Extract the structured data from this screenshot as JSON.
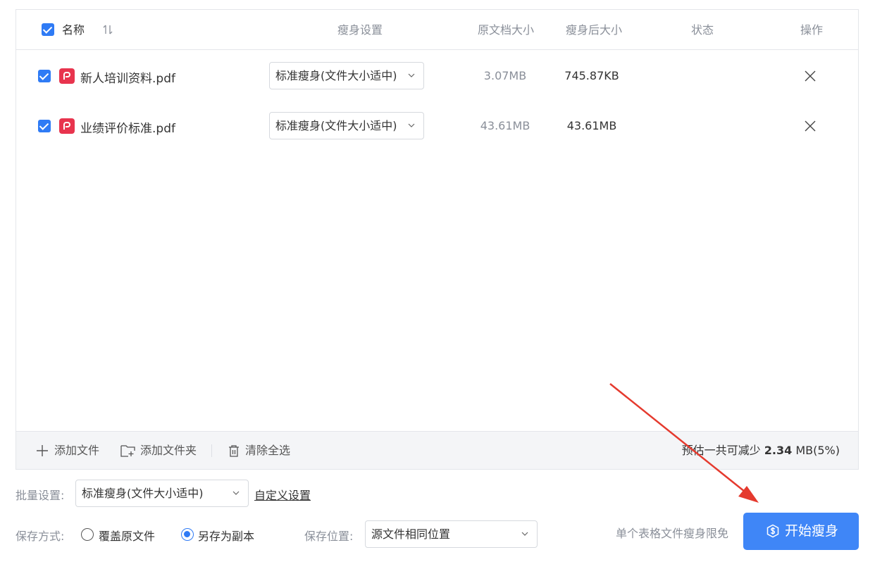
{
  "table": {
    "headers": {
      "name": "名称",
      "slim_setting": "瘦身设置",
      "original_size": "原文档大小",
      "slimmed_size": "瘦身后大小",
      "status": "状态",
      "action": "操作"
    },
    "rows": [
      {
        "name": "新人培训资料.pdf",
        "setting": "标准瘦身(文件大小适中)",
        "original_size": "3.07MB",
        "slimmed_size": "745.87KB",
        "status": ""
      },
      {
        "name": "业绩评价标准.pdf",
        "setting": "标准瘦身(文件大小适中)",
        "original_size": "43.61MB",
        "slimmed_size": "43.61MB",
        "status": ""
      }
    ]
  },
  "toolbar": {
    "add_file": "添加文件",
    "add_folder": "添加文件夹",
    "clear_all": "清除全选",
    "estimate_prefix": "预估一共可减少",
    "estimate_value": "2.34",
    "estimate_suffix": "MB(5%)"
  },
  "batch": {
    "label": "批量设置:",
    "value": "标准瘦身(文件大小适中)",
    "custom_link": "自定义设置"
  },
  "save": {
    "mode_label": "保存方式:",
    "overwrite": "覆盖原文件",
    "save_copy": "另存为副本",
    "selected": "save_copy",
    "location_label": "保存位置:",
    "location_value": "源文件相同位置"
  },
  "limit_text": "单个表格文件瘦身限免",
  "start_button": "开始瘦身",
  "colors": {
    "accent": "#3f86f7",
    "checkbox": "#2f7bf5",
    "pdf_icon": "#e8344e",
    "annotation_arrow": "#e53a2e"
  }
}
